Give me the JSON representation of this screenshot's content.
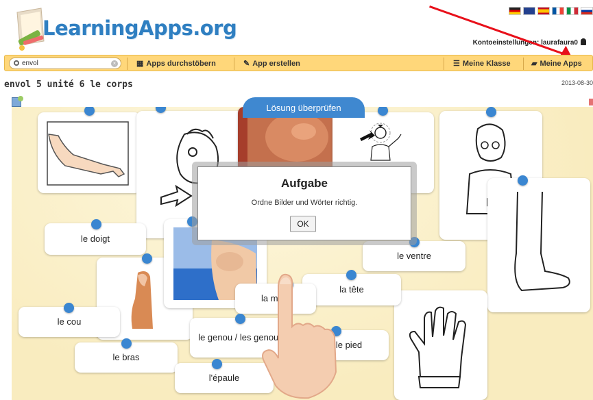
{
  "header": {
    "logo_text": "LearningApps.org",
    "account_text": "Kontoeinstellungen: laurafaura0",
    "flags": [
      "de",
      "en",
      "es",
      "fr",
      "it",
      "ru"
    ]
  },
  "navbar": {
    "search_value": "envol",
    "items": [
      {
        "icon": "grid-icon",
        "label": "Apps durchstöbern"
      },
      {
        "icon": "pencil-icon",
        "label": "App erstellen"
      },
      {
        "icon": "list-icon",
        "label": "Meine Klasse"
      },
      {
        "icon": "folder-icon",
        "label": "Meine Apps"
      }
    ]
  },
  "app": {
    "title": "envol 5 unité 6 le corps",
    "date": "2013-08-30",
    "check_button": "Lösung überprüfen"
  },
  "words": [
    "le doigt",
    "le ventre",
    "la tête",
    "la main",
    "le cou",
    "le genou / les genoux",
    "le pied",
    "le bras",
    "l'épaule"
  ],
  "modal": {
    "title": "Aufgabe",
    "text": "Ordne Bilder und Wörter richtig.",
    "ok_label": "OK"
  },
  "colors": {
    "accent": "#3a86d1",
    "navbar": "#ffd77a",
    "board": "#fbf2cf",
    "annotation": "#e8101a"
  }
}
